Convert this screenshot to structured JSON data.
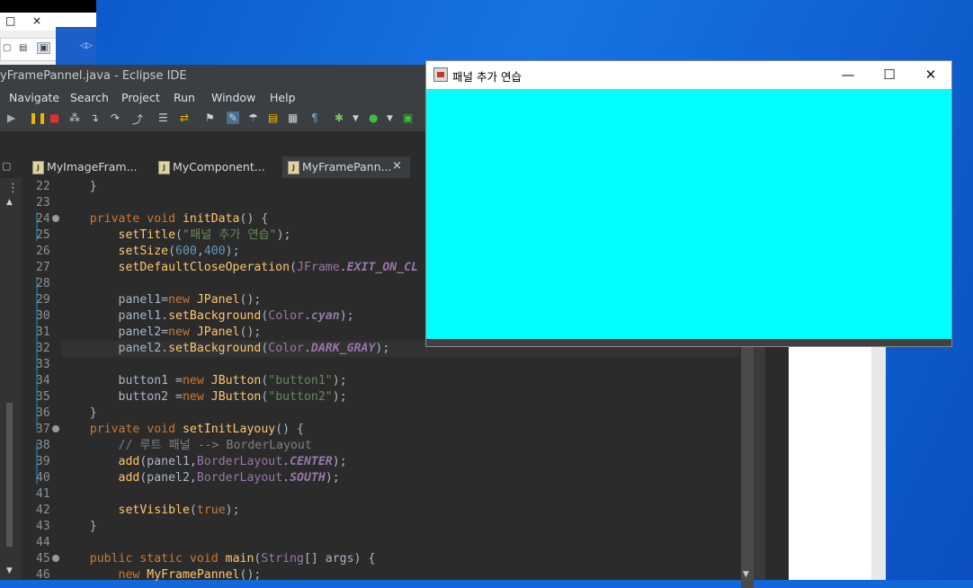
{
  "top_left_window": {
    "restore": "□",
    "close": "×"
  },
  "eclipse": {
    "title": "yFramePannel.java - Eclipse IDE",
    "menu": [
      "Navigate",
      "Search",
      "Project",
      "Run",
      "Window",
      "Help"
    ],
    "tabs": [
      {
        "label": "MyImageFram..."
      },
      {
        "label": "MyComponent..."
      },
      {
        "label": "MyFramePann..."
      }
    ],
    "tab_close": "×",
    "code": [
      {
        "n": "22",
        "parts": [
          {
            "c": "pl",
            "t": "    }"
          }
        ]
      },
      {
        "n": "23",
        "parts": []
      },
      {
        "n": "24",
        "fold": true,
        "parts": [
          {
            "c": "kw",
            "t": "    private void "
          },
          {
            "c": "fn",
            "t": "initData"
          },
          {
            "c": "pl",
            "t": "() {"
          }
        ]
      },
      {
        "n": "25",
        "parts": [
          {
            "c": "fn",
            "t": "        setTitle"
          },
          {
            "c": "pl",
            "t": "("
          },
          {
            "c": "str",
            "t": "\"패널 추가 연습\""
          },
          {
            "c": "pl",
            "t": ");"
          }
        ]
      },
      {
        "n": "26",
        "parts": [
          {
            "c": "fn",
            "t": "        setSize"
          },
          {
            "c": "pl",
            "t": "("
          },
          {
            "c": "num",
            "t": "600"
          },
          {
            "c": "pl",
            "t": ","
          },
          {
            "c": "num",
            "t": "400"
          },
          {
            "c": "pl",
            "t": ");"
          }
        ]
      },
      {
        "n": "27",
        "parts": [
          {
            "c": "fn",
            "t": "        setDefaultCloseOperation"
          },
          {
            "c": "pl",
            "t": "("
          },
          {
            "c": "cls",
            "t": "JFrame"
          },
          {
            "c": "pl",
            "t": "."
          },
          {
            "c": "sf",
            "t": "EXIT_ON_CL"
          }
        ]
      },
      {
        "n": "28",
        "parts": []
      },
      {
        "n": "29",
        "parts": [
          {
            "c": "pl",
            "t": "        panel1="
          },
          {
            "c": "kw",
            "t": "new "
          },
          {
            "c": "fn",
            "t": "JPanel"
          },
          {
            "c": "pl",
            "t": "();"
          }
        ]
      },
      {
        "n": "30",
        "parts": [
          {
            "c": "pl",
            "t": "        panel1."
          },
          {
            "c": "fn",
            "t": "setBackground"
          },
          {
            "c": "pl",
            "t": "("
          },
          {
            "c": "cls",
            "t": "Color"
          },
          {
            "c": "pl",
            "t": "."
          },
          {
            "c": "sf",
            "t": "cyan"
          },
          {
            "c": "pl",
            "t": ");"
          }
        ]
      },
      {
        "n": "31",
        "parts": [
          {
            "c": "pl",
            "t": "        panel2="
          },
          {
            "c": "kw",
            "t": "new "
          },
          {
            "c": "fn",
            "t": "JPanel"
          },
          {
            "c": "pl",
            "t": "();"
          }
        ]
      },
      {
        "n": "32",
        "parts": [
          {
            "c": "pl",
            "t": "        panel2."
          },
          {
            "c": "fn",
            "t": "setBackground"
          },
          {
            "c": "pl",
            "t": "("
          },
          {
            "c": "cls",
            "t": "Color"
          },
          {
            "c": "pl",
            "t": "."
          },
          {
            "c": "sf",
            "t": "DARK_GRAY"
          },
          {
            "c": "pl",
            "t": ");"
          }
        ]
      },
      {
        "n": "33",
        "parts": []
      },
      {
        "n": "34",
        "parts": [
          {
            "c": "pl",
            "t": "        button1 ="
          },
          {
            "c": "kw",
            "t": "new "
          },
          {
            "c": "fn",
            "t": "JButton"
          },
          {
            "c": "pl",
            "t": "("
          },
          {
            "c": "str",
            "t": "\"button1\""
          },
          {
            "c": "pl",
            "t": ");"
          }
        ]
      },
      {
        "n": "35",
        "parts": [
          {
            "c": "pl",
            "t": "        button2 ="
          },
          {
            "c": "kw",
            "t": "new "
          },
          {
            "c": "fn",
            "t": "JButton"
          },
          {
            "c": "pl",
            "t": "("
          },
          {
            "c": "str",
            "t": "\"button2\""
          },
          {
            "c": "pl",
            "t": ");"
          }
        ]
      },
      {
        "n": "36",
        "parts": [
          {
            "c": "pl",
            "t": "    }"
          }
        ]
      },
      {
        "n": "37",
        "fold": true,
        "parts": [
          {
            "c": "kw",
            "t": "    private void "
          },
          {
            "c": "fn",
            "t": "setInitLayouy"
          },
          {
            "c": "pl",
            "t": "() {"
          }
        ]
      },
      {
        "n": "38",
        "parts": [
          {
            "c": "cmt",
            "t": "        // 루트 패널 --> BorderLayout"
          }
        ]
      },
      {
        "n": "39",
        "parts": [
          {
            "c": "fn",
            "t": "        add"
          },
          {
            "c": "pl",
            "t": "(panel1,"
          },
          {
            "c": "cls",
            "t": "BorderLayout"
          },
          {
            "c": "pl",
            "t": "."
          },
          {
            "c": "sf",
            "t": "CENTER"
          },
          {
            "c": "pl",
            "t": ");"
          }
        ]
      },
      {
        "n": "40",
        "parts": [
          {
            "c": "fn",
            "t": "        add"
          },
          {
            "c": "pl",
            "t": "(panel2,"
          },
          {
            "c": "cls",
            "t": "BorderLayout"
          },
          {
            "c": "pl",
            "t": "."
          },
          {
            "c": "sf",
            "t": "SOUTH"
          },
          {
            "c": "pl",
            "t": ");"
          }
        ]
      },
      {
        "n": "41",
        "parts": []
      },
      {
        "n": "42",
        "parts": [
          {
            "c": "fn",
            "t": "        setVisible"
          },
          {
            "c": "pl",
            "t": "("
          },
          {
            "c": "kw",
            "t": "true"
          },
          {
            "c": "pl",
            "t": ");"
          }
        ]
      },
      {
        "n": "43",
        "parts": [
          {
            "c": "pl",
            "t": "    }"
          }
        ]
      },
      {
        "n": "44",
        "parts": []
      },
      {
        "n": "45",
        "fold": true,
        "parts": [
          {
            "c": "kw",
            "t": "    public static void "
          },
          {
            "c": "fn",
            "t": "main"
          },
          {
            "c": "pl",
            "t": "("
          },
          {
            "c": "cls",
            "t": "String"
          },
          {
            "c": "pl",
            "t": "[] args) {"
          }
        ]
      },
      {
        "n": "46",
        "parts": [
          {
            "c": "kw",
            "t": "        new "
          },
          {
            "c": "fn",
            "t": "MyFramePannel"
          },
          {
            "c": "pl",
            "t": "();"
          }
        ]
      }
    ]
  },
  "java_frame": {
    "title": "패널 추가 연습",
    "minimize": "—",
    "maximize": "☐",
    "close": "✕",
    "center_panel_color": "#00ffff",
    "south_panel_color": "#404040"
  }
}
